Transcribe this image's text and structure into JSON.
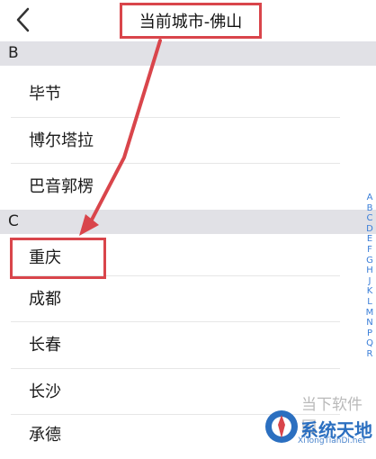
{
  "header": {
    "title": "当前城市-佛山",
    "back_icon": "chevron-left-icon"
  },
  "sections": [
    {
      "letter": "B",
      "items": [
        "毕节",
        "博尔塔拉",
        "巴音郭楞"
      ]
    },
    {
      "letter": "C",
      "items": [
        "重庆",
        "成都",
        "长春",
        "长沙",
        "承德"
      ]
    }
  ],
  "index_letters": [
    "A",
    "B",
    "C",
    "D",
    "E",
    "F",
    "G",
    "H",
    "J",
    "K",
    "L",
    "M",
    "N",
    "P",
    "Q",
    "R"
  ],
  "annotation": {
    "color": "#d9454b"
  },
  "watermark": {
    "line1": "当下软件园",
    "line2": "系统天地",
    "line3": "XiTongTianDi.net"
  }
}
